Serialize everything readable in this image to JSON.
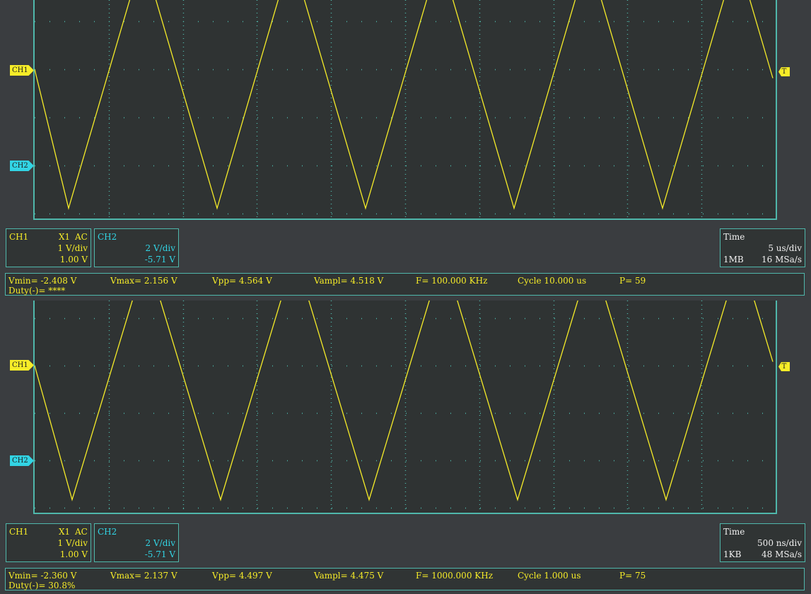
{
  "colors": {
    "grid_background": "#2f3333",
    "grid_border": "#4fb7ab",
    "ch1": "#f6ec28",
    "ch2": "#32d4e4",
    "screen_background": "#3a3d40"
  },
  "icons": {
    "ch1_marker": "ch1-position-arrow-icon",
    "ch2_marker": "ch2-position-arrow-icon",
    "trigger_marker": "trigger-level-icon"
  },
  "panels": [
    {
      "markers": {
        "ch1": "CH1",
        "ch2": "CH2",
        "trigger": "T"
      },
      "ch1": {
        "label": "CH1",
        "probe": "X1",
        "coupling": "AC",
        "scale": "1 V/div",
        "offset": "1.00 V"
      },
      "ch2": {
        "label": "CH2",
        "scale": "2 V/div",
        "offset": "-5.71 V"
      },
      "time": {
        "label": "Time",
        "scale": "5 us/div",
        "depth": "1MB",
        "rate": "16 MSa/s"
      },
      "measurements": {
        "vmin": "Vmin= -2.408 V",
        "vmax": "Vmax= 2.156 V",
        "vpp": "Vpp= 4.564 V",
        "vampl": "Vampl= 4.518 V",
        "freq": "F= 100.000 KHz",
        "cycle": "Cycle 10.000 us",
        "points": "P= 59",
        "duty": "Duty(-)= ****"
      },
      "waveform": {
        "type": "triangle",
        "cycles_on_screen": 5,
        "vmax": 2.156,
        "vmin": -2.408,
        "volts_per_div": 1
      }
    },
    {
      "markers": {
        "ch1": "CH1",
        "ch2": "CH2",
        "trigger": "T"
      },
      "ch1": {
        "label": "CH1",
        "probe": "X1",
        "coupling": "AC",
        "scale": "1 V/div",
        "offset": "1.00 V"
      },
      "ch2": {
        "label": "CH2",
        "scale": "2 V/div",
        "offset": "-5.71 V"
      },
      "time": {
        "label": "Time",
        "scale": "500 ns/div",
        "depth": "1KB",
        "rate": "48 MSa/s"
      },
      "measurements": {
        "vmin": "Vmin= -2.360 V",
        "vmax": "Vmax= 2.137 V",
        "vpp": "Vpp= 4.497 V",
        "vampl": "Vampl= 4.475 V",
        "freq": "F= 1000.000 KHz",
        "cycle": "Cycle 1.000 us",
        "points": "P= 75",
        "duty": "Duty(-)= 30.8%"
      },
      "waveform": {
        "type": "triangle",
        "cycles_on_screen": 5,
        "vmax": 2.137,
        "vmin": -2.36,
        "volts_per_div": 1
      }
    }
  ]
}
